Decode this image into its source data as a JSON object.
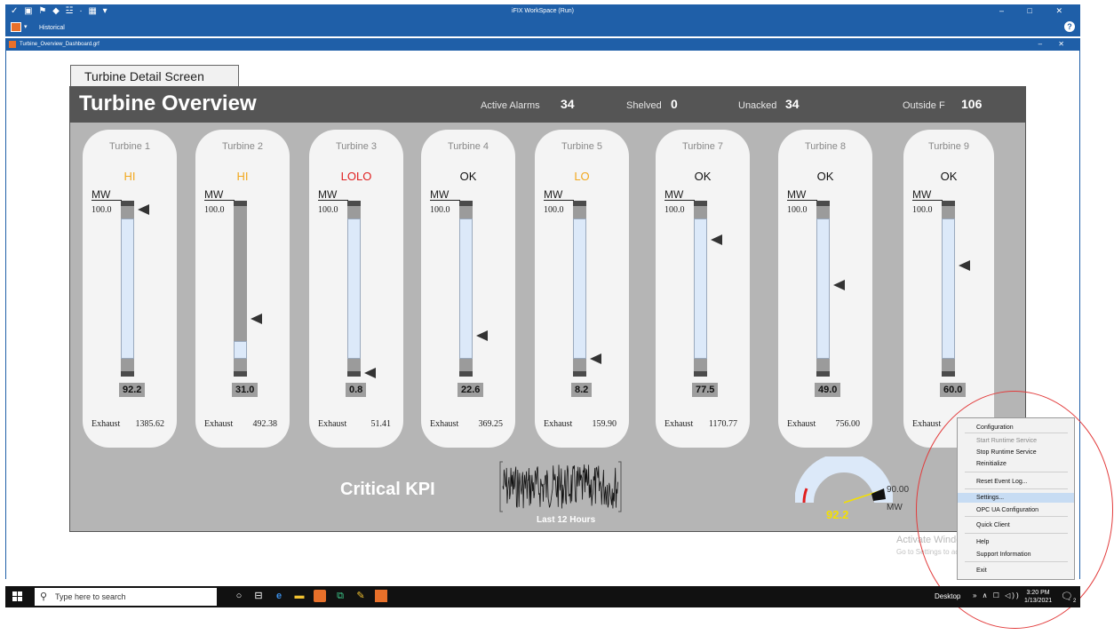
{
  "window": {
    "title": "iFIX WorkSpace (Run)",
    "quick_access": "✓ ▣ ⚑ ◆ ☳ · ▦ ▾",
    "controls": "– □ ✕",
    "menu_tab": "Historical",
    "help": "?"
  },
  "document": {
    "title": "Turbine_Overview_Dashboard.grf",
    "controls": "– ✕"
  },
  "detail_tab": "Turbine Detail Screen",
  "dashboard": {
    "title": "Turbine Overview",
    "stats": [
      {
        "label": "Active Alarms",
        "value": "34"
      },
      {
        "label": "Shelved",
        "value": "0"
      },
      {
        "label": "Unacked",
        "value": "34"
      },
      {
        "label": "Outside F",
        "value": "106"
      }
    ],
    "mw_label": "MW",
    "max_label": "100.0",
    "exhaust_label": "Exhaust",
    "turbines": [
      {
        "name": "Turbine 1",
        "status": "HI",
        "status_color": "#f2a81e",
        "value": "92.2",
        "level": 0.922,
        "setpoint_level": 0.95,
        "fill_level": 0.93,
        "exhaust": "1385.62"
      },
      {
        "name": "Turbine 2",
        "status": "HI",
        "status_color": "#f2a81e",
        "value": "31.0",
        "level": 0.31,
        "setpoint_level": 0.33,
        "fill_level": 0.2,
        "exhaust": "492.38"
      },
      {
        "name": "Turbine 3",
        "status": "LOLO",
        "status_color": "#e02020",
        "value": "0.8",
        "level": 0.008,
        "setpoint_level": 0.02,
        "fill_level": 0.93,
        "exhaust": "51.41"
      },
      {
        "name": "Turbine 4",
        "status": "OK",
        "status_color": "#111111",
        "value": "22.6",
        "level": 0.226,
        "setpoint_level": 0.23,
        "fill_level": 0.93,
        "exhaust": "369.25"
      },
      {
        "name": "Turbine 5",
        "status": "LO",
        "status_color": "#f2a81e",
        "value": "8.2",
        "level": 0.082,
        "setpoint_level": 0.1,
        "fill_level": 0.93,
        "exhaust": "159.90"
      },
      {
        "name": "Turbine 7",
        "status": "OK",
        "status_color": "#111111",
        "value": "77.5",
        "level": 0.775,
        "setpoint_level": 0.78,
        "fill_level": 0.93,
        "exhaust": "1170.77"
      },
      {
        "name": "Turbine 8",
        "status": "OK",
        "status_color": "#111111",
        "value": "49.0",
        "level": 0.49,
        "setpoint_level": 0.52,
        "fill_level": 0.93,
        "exhaust": "756.00"
      },
      {
        "name": "Turbine 9",
        "status": "OK",
        "status_color": "#111111",
        "value": "60.0",
        "level": 0.6,
        "setpoint_level": 0.63,
        "fill_level": 0.93,
        "exhaust": ""
      }
    ],
    "kpi": {
      "title": "Critical KPI",
      "trend_label": "Last 12 Hours",
      "gauge_value": "92.2",
      "gauge_max": "90.00",
      "gauge_unit": "MW",
      "gauge_level": 0.922
    }
  },
  "context_menu": {
    "items": [
      {
        "label": "Configuration",
        "disabled": false
      },
      {
        "label": "Start Runtime Service",
        "disabled": true
      },
      {
        "label": "Stop Runtime Service",
        "disabled": false
      },
      {
        "label": "Reinitialize",
        "disabled": false
      },
      {
        "label": "Reset Event Log...",
        "disabled": false
      },
      {
        "label": "Settings...",
        "disabled": false,
        "highlighted": true
      },
      {
        "label": "OPC UA Configuration",
        "disabled": false
      },
      {
        "label": "Quick Client",
        "disabled": false
      },
      {
        "label": "Help",
        "disabled": false
      },
      {
        "label": "Support Information",
        "disabled": false
      },
      {
        "label": "Exit",
        "disabled": false
      }
    ]
  },
  "watermark": {
    "line1": "Activate Windows",
    "line2": "Go to Settings to activate Windows."
  },
  "taskbar": {
    "search_placeholder": "Type here to search",
    "desktop_label": "Desktop",
    "tray_icons": "» ∧ ☐ ◁))",
    "time": "3:20 PM",
    "date": "1/13/2021",
    "notification_count": "2",
    "pinned_icons": [
      "circle-icon",
      "task-view-icon",
      "edge-icon",
      "file-explorer-icon",
      "ifix-icon",
      "ifix-workspace-icon",
      "tool-icon",
      "dashboard-icon"
    ]
  },
  "colors": {
    "title_bar": "#1f5fa8",
    "dashboard_bg": "#b5b5b5",
    "header_bg": "#555555",
    "bar_fill": "#dce9f9",
    "alarm_orange": "#f2a81e",
    "alarm_red": "#e02020",
    "gauge_value": "#f4e000",
    "highlight_circle": "#e23b3b"
  }
}
